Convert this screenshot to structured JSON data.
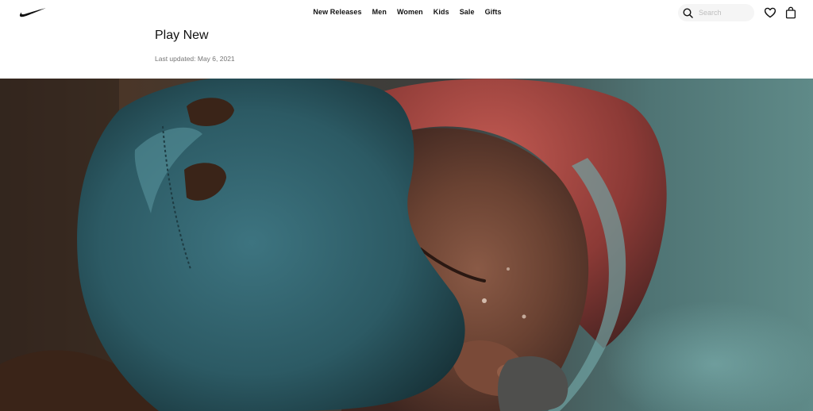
{
  "nav": {
    "logo_icon": "nike-swoosh-icon",
    "menu_items": [
      {
        "label": "New Releases"
      },
      {
        "label": "Men"
      },
      {
        "label": "Women"
      },
      {
        "label": "Kids"
      },
      {
        "label": "Sale"
      },
      {
        "label": "Gifts"
      }
    ],
    "search": {
      "placeholder": "Search",
      "value": "",
      "icon": "search-icon"
    },
    "favorites_icon": "heart-icon",
    "bag_icon": "bag-icon"
  },
  "header": {
    "title": "Play New",
    "last_updated": "Last updated: May 6, 2021"
  },
  "hero": {
    "subject": "boxer-headgear-photo"
  },
  "colors": {
    "text": "#111111",
    "muted": "#757575",
    "search_bg": "#f5f5f5",
    "headgear_blue": "#2f5d66",
    "headgear_red": "#b84a45"
  }
}
